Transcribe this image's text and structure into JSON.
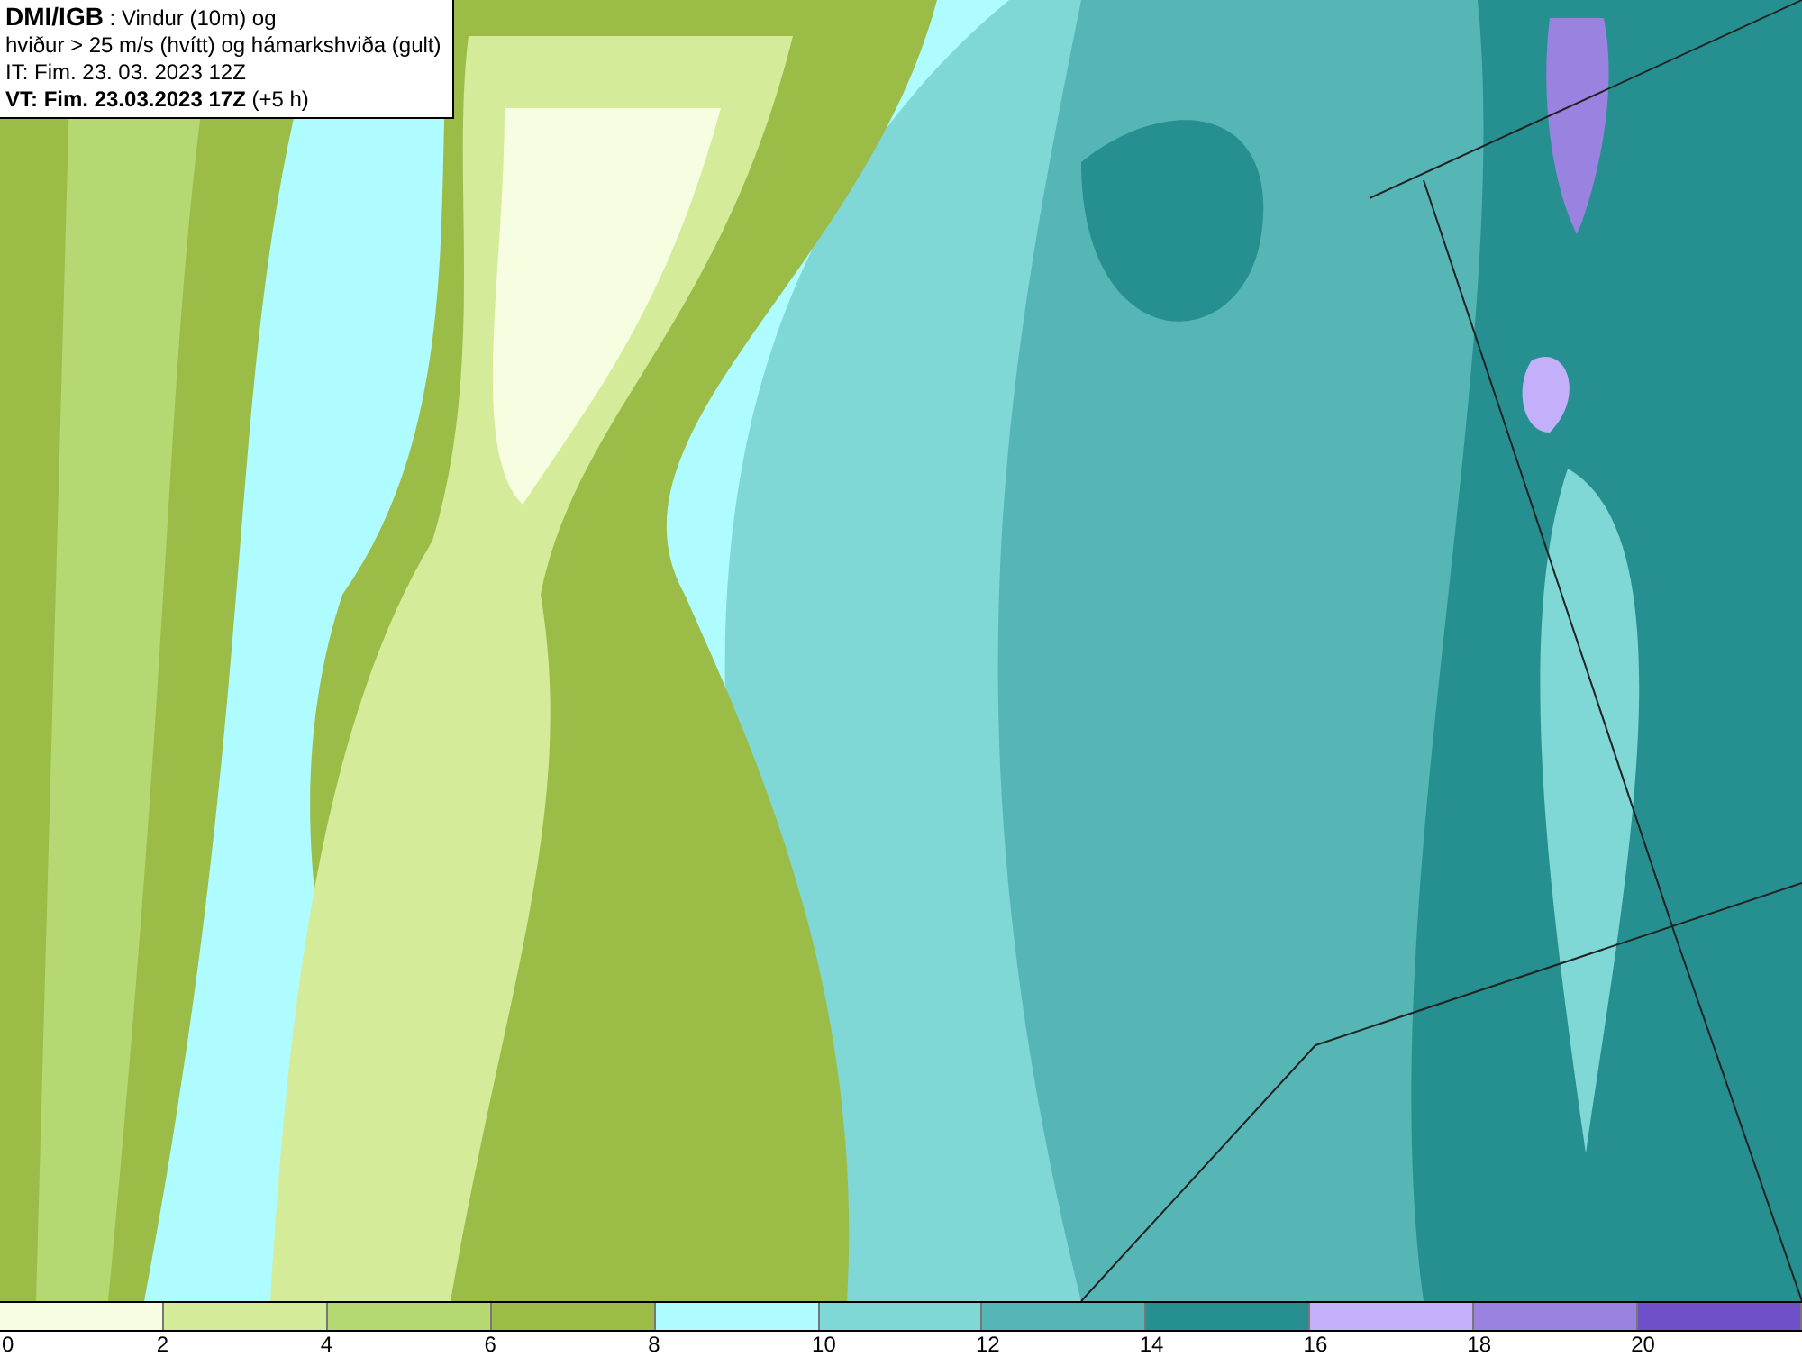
{
  "title_box": {
    "lines": [
      "**DMI/IGB** : Vindur (10m) og",
      "hviður > 25 m/s (hvítt) og hámarkshviða (gult)",
      "IT: Fim. 23. 03. 2023 12Z",
      "**VT: Fim. 23.03.2023 17Z** (+5 h)"
    ]
  },
  "legend": {
    "segments": [
      {
        "color": "#f7fde0"
      },
      {
        "color": "#d4eb9a"
      },
      {
        "color": "#b5d873"
      },
      {
        "color": "#9bbd48"
      },
      {
        "color": "#aefcff"
      },
      {
        "color": "#7fd7d6"
      },
      {
        "color": "#56b5b5"
      },
      {
        "color": "#25908f"
      },
      {
        "color": "#c4b0fa"
      },
      {
        "color": "#9a82e0"
      },
      {
        "color": "#6f50c8"
      }
    ],
    "ticks": [
      "0",
      "2",
      "4",
      "6",
      "8",
      "10",
      "12",
      "14",
      "16",
      "18",
      "20"
    ]
  }
}
